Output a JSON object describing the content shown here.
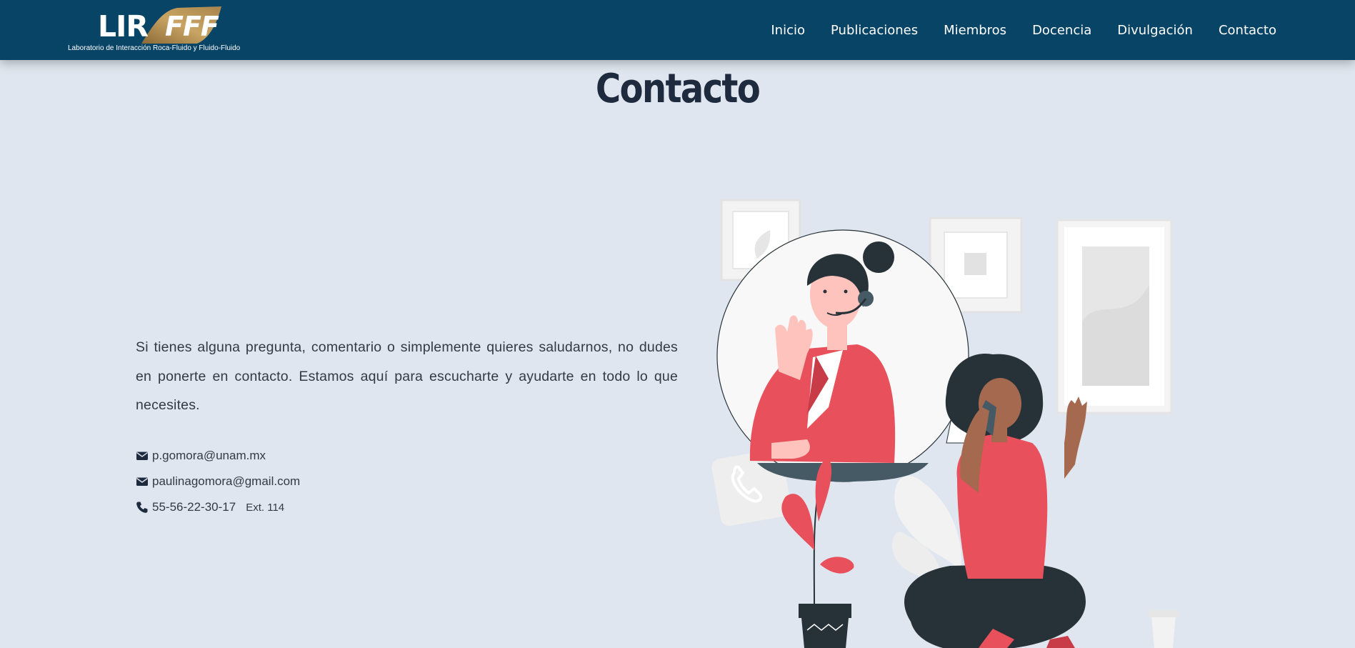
{
  "header": {
    "logo_main": "LIR",
    "logo_accent": "FFF",
    "logo_subtitle": "Laboratorio de Interacción Roca-Fluido y Fluido-Fluido",
    "nav": [
      {
        "label": "Inicio"
      },
      {
        "label": "Publicaciones"
      },
      {
        "label": "Miembros"
      },
      {
        "label": "Docencia"
      },
      {
        "label": "Divulgación"
      },
      {
        "label": "Contacto"
      }
    ]
  },
  "main": {
    "title": "Contacto",
    "intro": "Si tienes alguna pregunta, comentario o simplemente quieres saludarnos, no dudes en ponerte en contacto. Estamos aquí para escucharte y ayudarte en todo lo que necesites.",
    "contacts": [
      {
        "icon": "envelope-icon",
        "value": "p.gomora@unam.mx"
      },
      {
        "icon": "envelope-icon",
        "value": "paulinagomora@gmail.com"
      },
      {
        "icon": "phone-icon",
        "value": "55-56-22-30-17",
        "extension": "Ext. 114"
      }
    ]
  },
  "colors": {
    "navbar": "#084466",
    "page_background": "#e0e6ef",
    "title": "#1e2a3e",
    "body_text": "#333945",
    "logo_gold": "#b08a4e",
    "illustration_red": "#e8505b",
    "illustration_dark": "#263238"
  }
}
